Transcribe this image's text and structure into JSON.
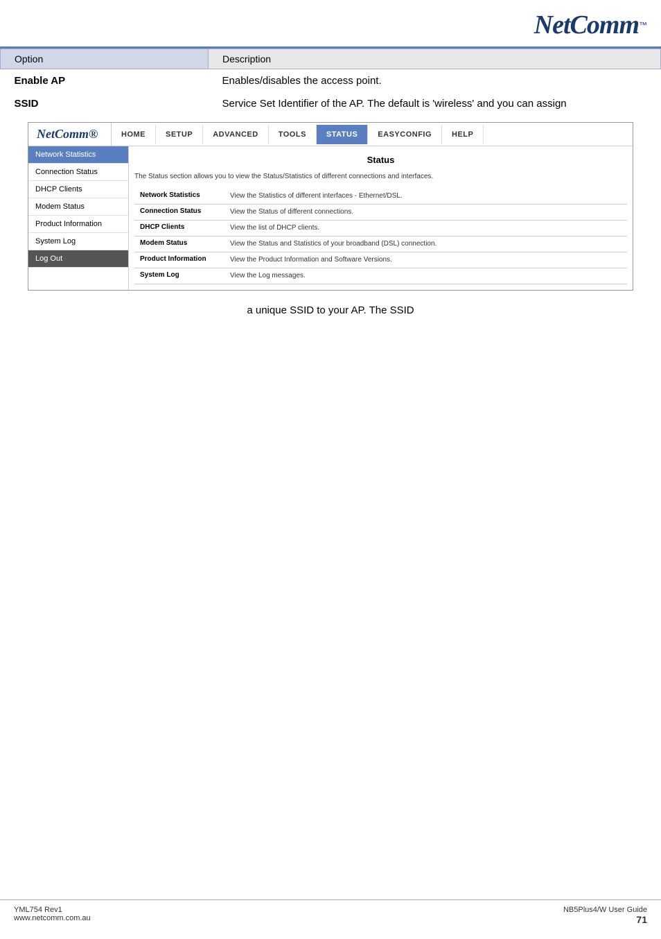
{
  "header": {
    "logo": "NetComm",
    "tm": "™"
  },
  "table": {
    "col_option": "Option",
    "col_description": "Description",
    "rows": [
      {
        "option": "Enable AP",
        "description": "Enables/disables the access point."
      },
      {
        "option": "SSID",
        "description": "Service Set Identifier of the AP. The default is 'wireless' and you can assign"
      }
    ]
  },
  "router_ui": {
    "logo": "NetComm®",
    "nav_items": [
      "HOME",
      "SETUP",
      "ADVANCED",
      "TOOLS",
      "STATUS",
      "EASYCONFIG",
      "HELP"
    ],
    "active_nav": "STATUS",
    "sidebar": {
      "items": [
        {
          "label": "Network Statistics",
          "state": "active"
        },
        {
          "label": "Connection Status",
          "state": "normal"
        },
        {
          "label": "DHCP Clients",
          "state": "normal"
        },
        {
          "label": "Modem Status",
          "state": "normal"
        },
        {
          "label": "Product Information",
          "state": "normal"
        },
        {
          "label": "System Log",
          "state": "normal"
        },
        {
          "label": "Log Out",
          "state": "dark"
        }
      ]
    },
    "content": {
      "title": "Status",
      "intro": "The Status section allows you to view the Status/Statistics of different connections and interfaces.",
      "status_rows": [
        {
          "label": "Network Statistics",
          "desc": "View the Statistics of different interfaces - Ethernet/DSL."
        },
        {
          "label": "Connection Status",
          "desc": "View the Status of different connections."
        },
        {
          "label": "DHCP Clients",
          "desc": "View the list of DHCP clients."
        },
        {
          "label": "Modem Status",
          "desc": "View the Status and Statistics of your broadband (DSL) connection."
        },
        {
          "label": "Product Information",
          "desc": "View the Product Information and Software Versions."
        },
        {
          "label": "System Log",
          "desc": "View the Log messages."
        }
      ]
    }
  },
  "bottom_text": "a unique SSID to your AP.  The SSID",
  "footer": {
    "left_line1": "YML754 Rev1",
    "left_line2": "www.netcomm.com.au",
    "right_line1": "NB5Plus4/W User Guide",
    "page_number": "71"
  }
}
